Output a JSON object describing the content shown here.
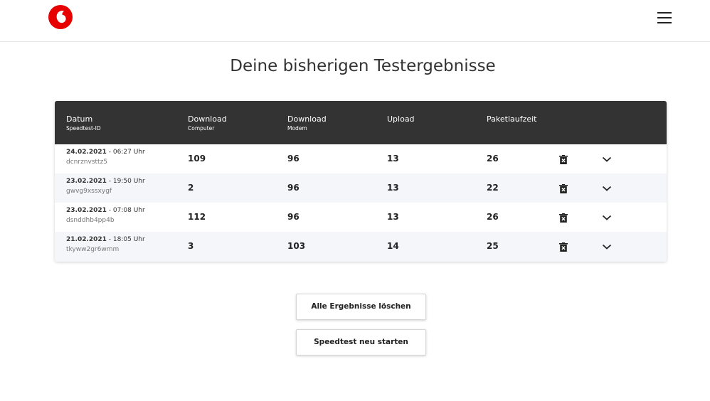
{
  "header": {
    "logo_icon": "vodafone-logo",
    "menu_icon": "hamburger-menu-icon",
    "brand_color": "#e60000"
  },
  "title": "Deine bisherigen Testergebnisse",
  "table": {
    "columns": [
      {
        "main": "Datum",
        "sub": "Speedtest-ID"
      },
      {
        "main": "Download",
        "sub": "Computer"
      },
      {
        "main": "Download",
        "sub": "Modem"
      },
      {
        "main": "Upload",
        "sub": ""
      },
      {
        "main": "Paketlaufzeit",
        "sub": ""
      }
    ],
    "rows": [
      {
        "date": "24.02.2021",
        "time": " - 06:27 Uhr",
        "id": "dcnrznvsttz5",
        "download_computer": "109",
        "download_modem": "96",
        "upload": "13",
        "ping": "26"
      },
      {
        "date": "23.02.2021",
        "time": " - 19:50 Uhr",
        "id": "gwvg9xssxygf",
        "download_computer": "2",
        "download_modem": "96",
        "upload": "13",
        "ping": "22"
      },
      {
        "date": "23.02.2021",
        "time": " - 07:08 Uhr",
        "id": "dsnddhb4pp4b",
        "download_computer": "112",
        "download_modem": "96",
        "upload": "13",
        "ping": "26"
      },
      {
        "date": "21.02.2021",
        "time": " - 18:05 Uhr",
        "id": "tkyww2gr6wmm",
        "download_computer": "3",
        "download_modem": "103",
        "upload": "14",
        "ping": "25"
      }
    ],
    "row_icons": {
      "delete": "trash-icon",
      "expand": "chevron-down-icon"
    },
    "header_color": "#333333"
  },
  "buttons": {
    "delete_all": "Alle Ergebnisse löschen",
    "restart": "Speedtest neu starten"
  }
}
